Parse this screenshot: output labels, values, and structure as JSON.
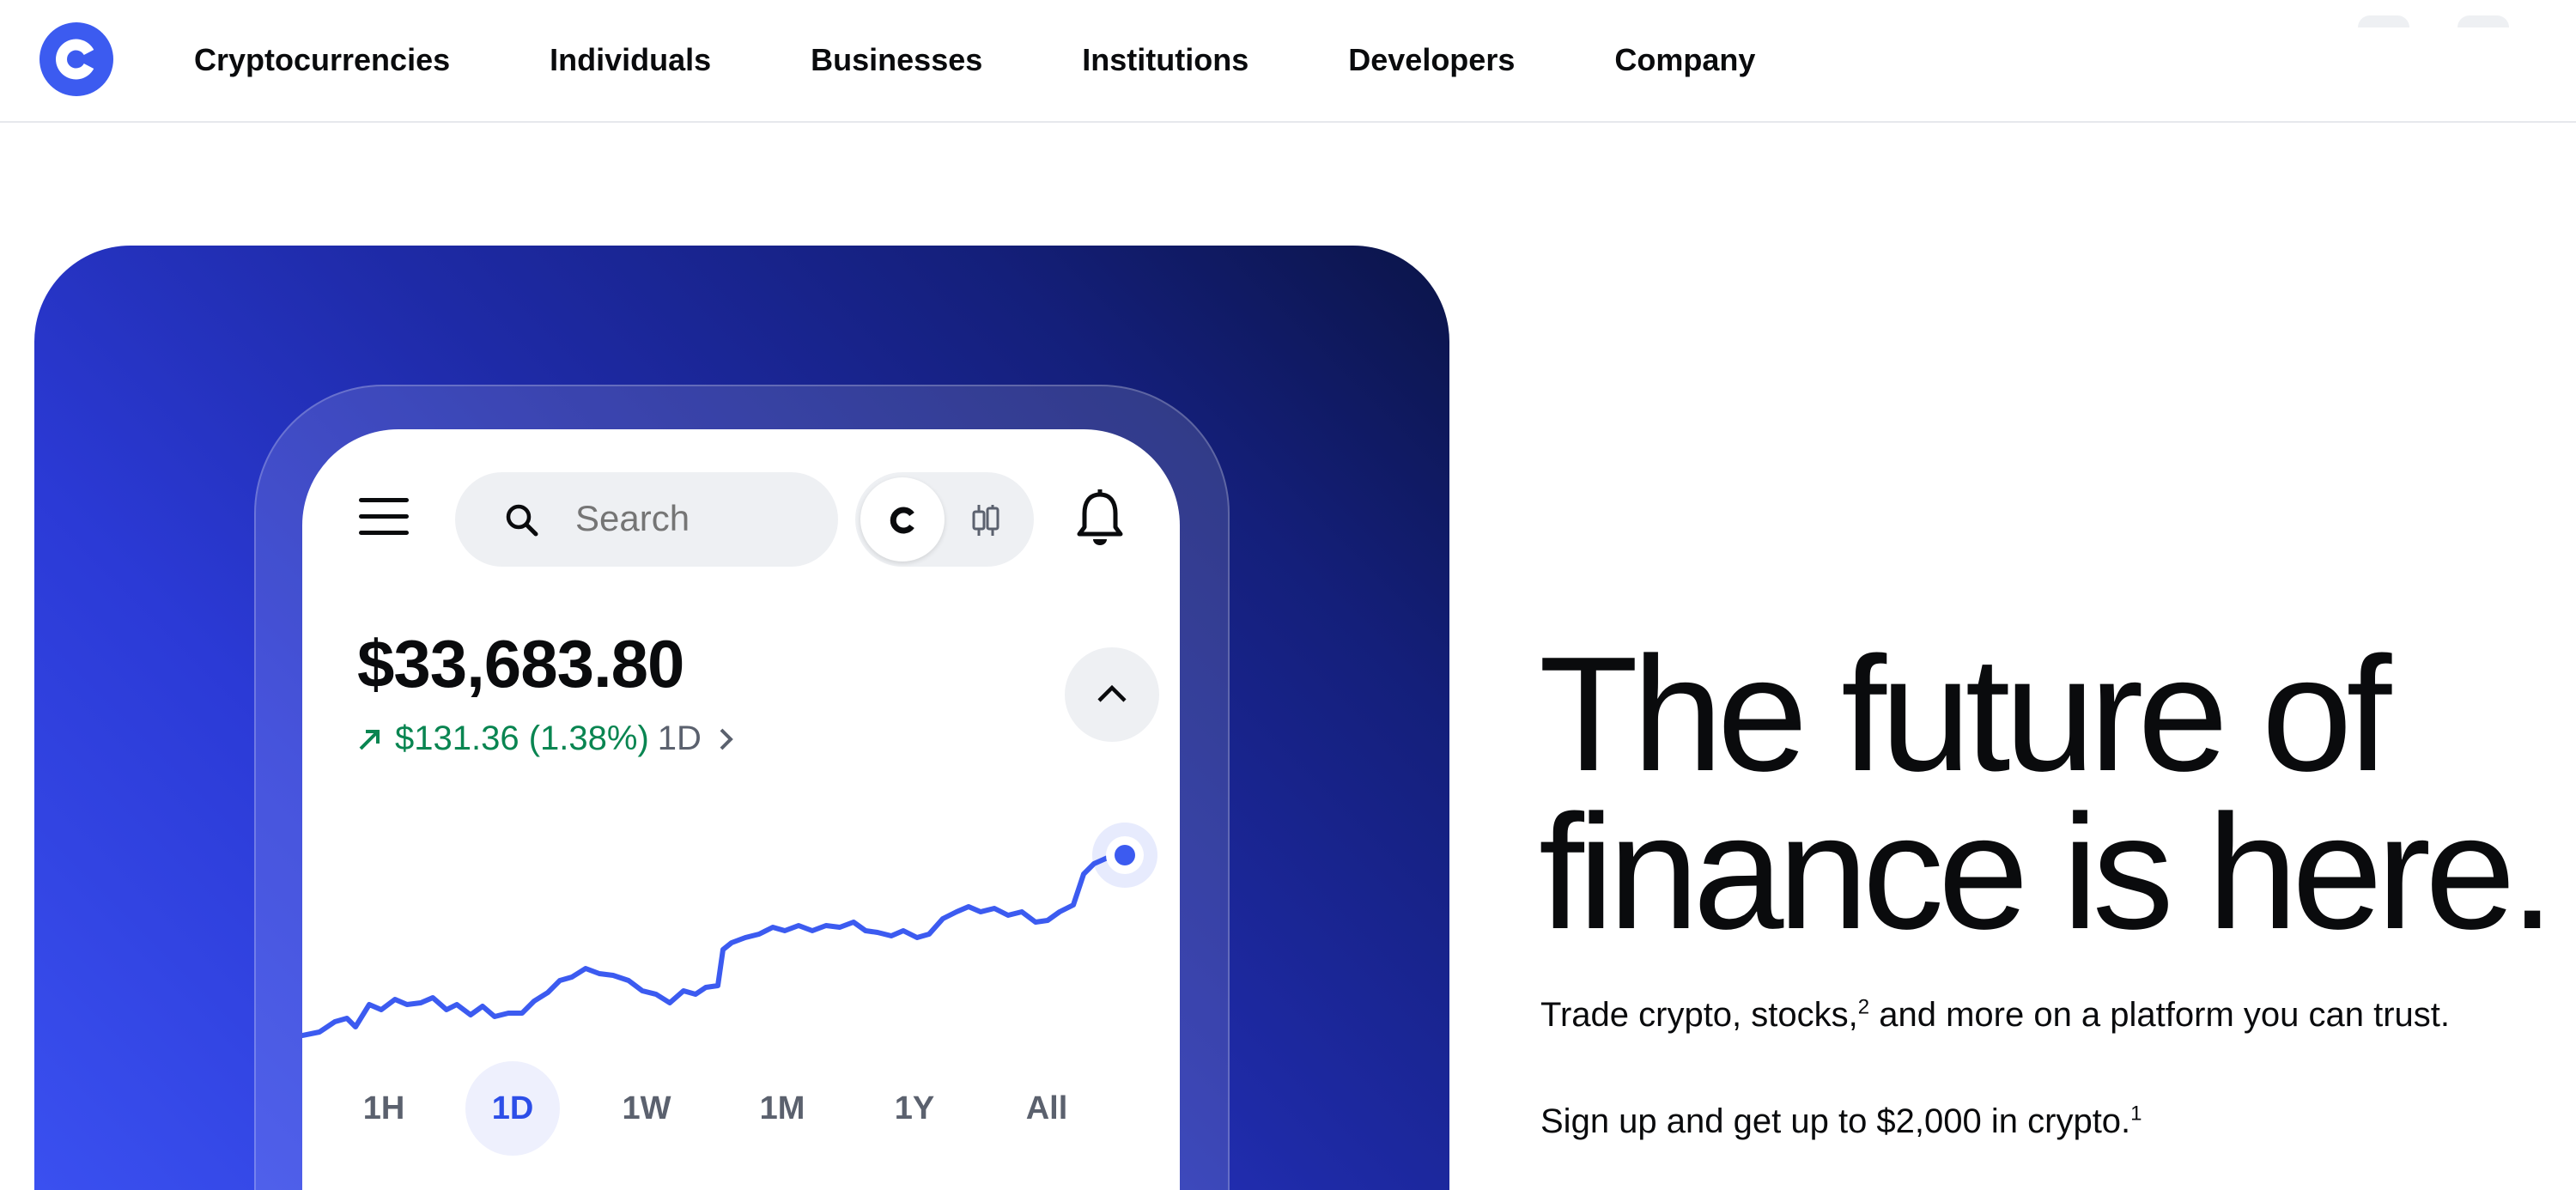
{
  "brand": {
    "logo_icon": "coinbase-c-logo-icon",
    "accent": "#3c5bf0"
  },
  "nav": {
    "items": [
      {
        "label": "Cryptocurrencies"
      },
      {
        "label": "Individuals"
      },
      {
        "label": "Businesses"
      },
      {
        "label": "Institutions"
      },
      {
        "label": "Developers"
      },
      {
        "label": "Company"
      }
    ]
  },
  "phone": {
    "menu_icon": "hamburger-menu-icon",
    "search": {
      "placeholder": "Search",
      "icon": "search-icon"
    },
    "toggle": {
      "left_icon": "coinbase-c-icon",
      "right_icon": "candlestick-icon"
    },
    "bell_icon": "bell-icon",
    "balance": "$33,683.80",
    "change": {
      "value": "$131.36 (1.38%)",
      "period": "1D",
      "direction": "up",
      "color": "#098551"
    },
    "collapse_icon": "chevron-up-icon",
    "ranges": [
      {
        "label": "1H",
        "active": false
      },
      {
        "label": "1D",
        "active": true
      },
      {
        "label": "1W",
        "active": false
      },
      {
        "label": "1M",
        "active": false
      },
      {
        "label": "1Y",
        "active": false
      },
      {
        "label": "All",
        "active": false
      }
    ],
    "chart_line_color": "#3c5bf0"
  },
  "hero": {
    "headline_line1": "The future of",
    "headline_line2": "finance is here.",
    "sub1_text": "Trade crypto, stocks,",
    "sub1_sup": "2",
    "sub1_rest": " and more on a platform you can trust.",
    "sub2_text": "Sign up and get up to $2,000 in crypto.",
    "sub2_sup": "1"
  }
}
